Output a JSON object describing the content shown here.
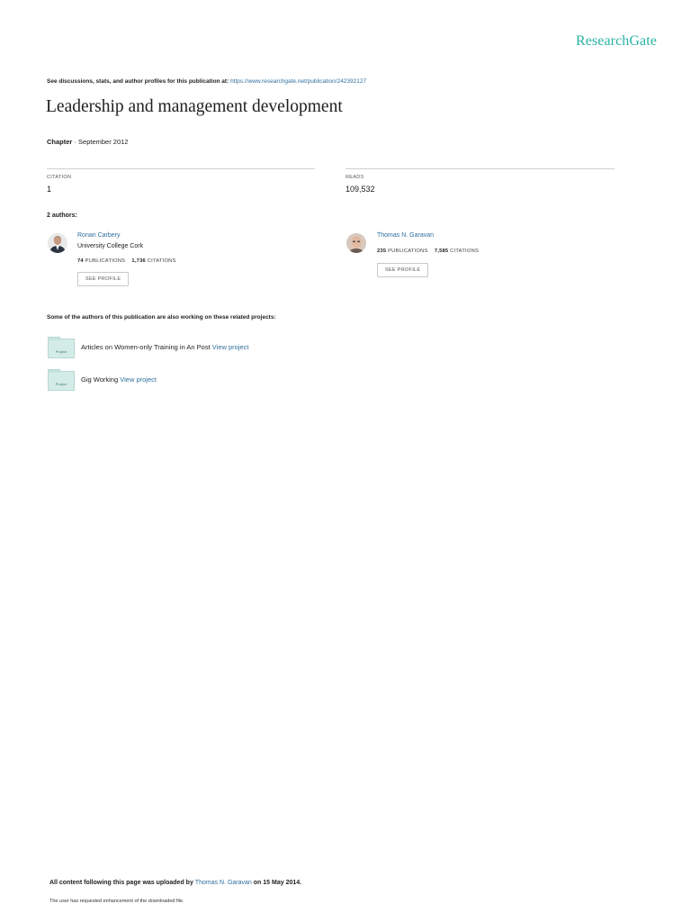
{
  "brand": "ResearchGate",
  "top_note": {
    "text": "See discussions, stats, and author profiles for this publication at: ",
    "url": "https://www.researchgate.net/publication/242392127"
  },
  "title": "Leadership and management development",
  "meta": {
    "kind": "Chapter",
    "separator": " · ",
    "date": "September 2012"
  },
  "stats": {
    "citation_label": "CITATION",
    "citation_value": "1",
    "reads_label": "READS",
    "reads_value": "109,532"
  },
  "authors_heading": "2 authors:",
  "authors": [
    {
      "name": "Ronan Carbery",
      "institution": "University College Cork",
      "publications_count": "74",
      "publications_label": "PUBLICATIONS",
      "citations_count": "1,736",
      "citations_label": "CITATIONS",
      "button": "SEE PROFILE"
    },
    {
      "name": "Thomas N. Garavan",
      "institution": "",
      "publications_count": "235",
      "publications_label": "PUBLICATIONS",
      "citations_count": "7,585",
      "citations_label": "CITATIONS",
      "button": "SEE PROFILE"
    }
  ],
  "projects_heading": "Some of the authors of this publication are also working on these related projects:",
  "projects": [
    {
      "icon_label": "Project",
      "title": "Articles on Women-only Training in An Post",
      "link": "View project"
    },
    {
      "icon_label": "Project",
      "title": "Gig Working",
      "link": "View project"
    }
  ],
  "footer": {
    "upload_prefix": "All content following this page was uploaded by ",
    "uploader": "Thomas N. Garavan",
    "upload_suffix": " on 15 May 2014.",
    "note": "The user has requested enhancement of the downloaded file."
  },
  "colors": {
    "brand": "#28b3a3",
    "link": "#2f6f9f",
    "project_icon": "#d4ece8"
  }
}
